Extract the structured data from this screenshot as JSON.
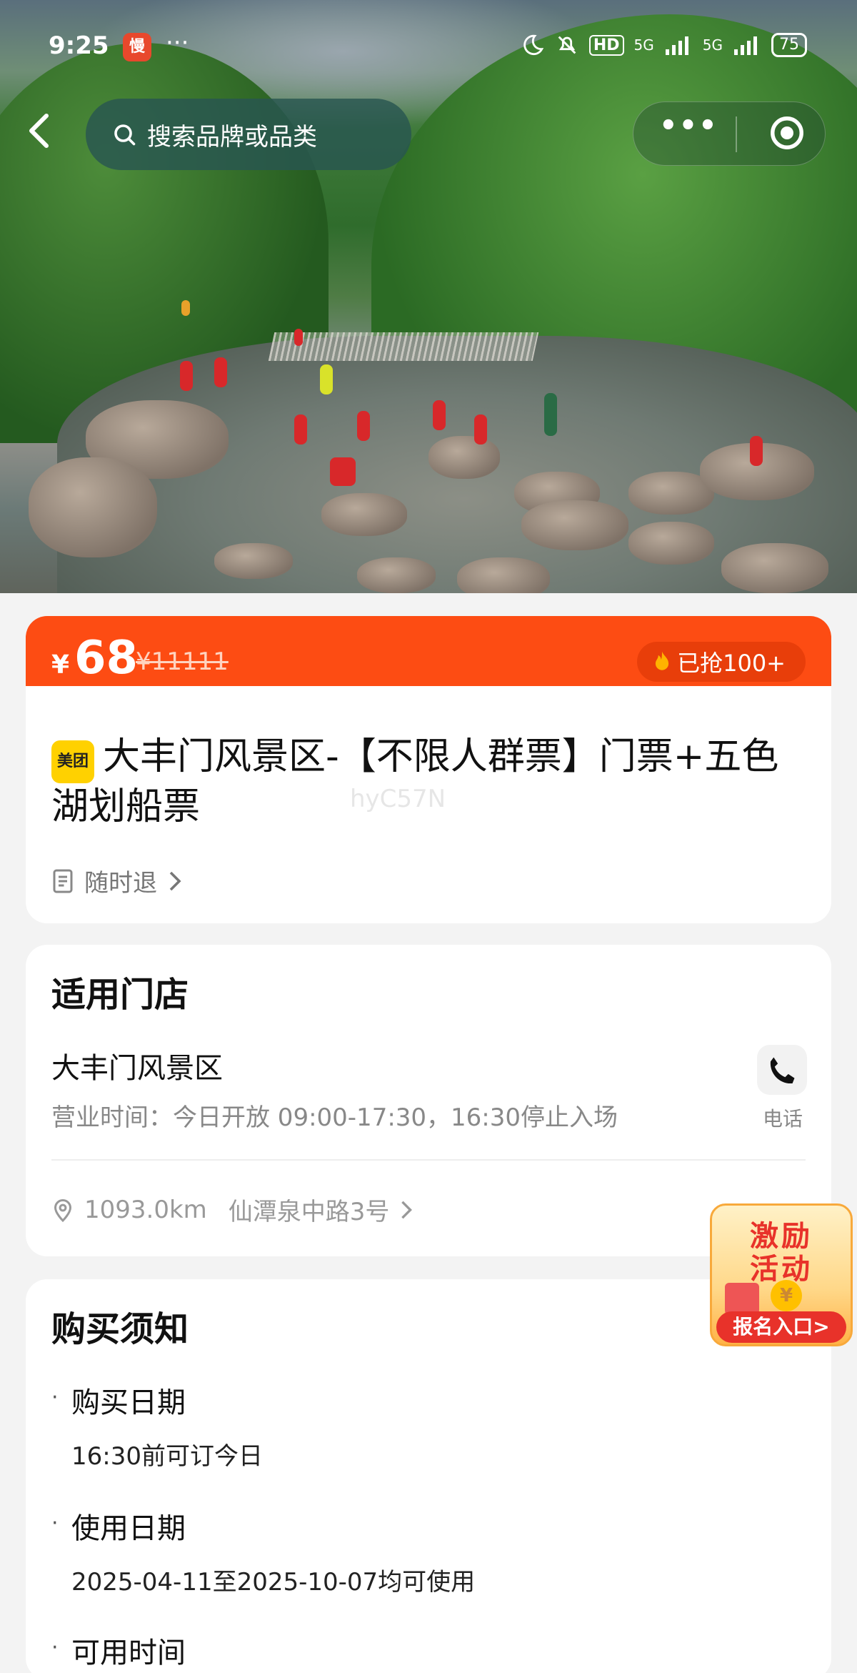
{
  "status_bar": {
    "time": "9:25",
    "app_badge": "慢",
    "dots": "···",
    "signal1": "5G",
    "signal2": "5G",
    "hd": "HD",
    "battery": "75"
  },
  "nav": {
    "search_placeholder": "搜索品牌或品类",
    "more": "•••"
  },
  "price": {
    "currency": "¥",
    "amount": "68",
    "original": "¥11111",
    "sold": "已抢100+"
  },
  "product": {
    "brand_badge": "美团",
    "title": "大丰门风景区-【不限人群票】门票+五色湖划船票",
    "refund": "随时退",
    "watermark": "hyC57N"
  },
  "store": {
    "section_title": "适用门店",
    "name": "大丰门风景区",
    "hours": "营业时间：今日开放 09:00-17:30，16:30停止入场",
    "phone_label": "电话",
    "distance": "1093.0km",
    "address": "仙潭泉中路3号"
  },
  "notice": {
    "section_title": "购买须知",
    "items": [
      {
        "heading": "购买日期",
        "value": "16:30前可订今日"
      },
      {
        "heading": "使用日期",
        "value": "2025-04-11至2025-10-07均可使用"
      },
      {
        "heading": "可用时间",
        "value": ""
      }
    ]
  },
  "promo": {
    "line1": "激励",
    "line2": "活动",
    "button": "报名入口>"
  },
  "colors": {
    "accent": "#fd4c13",
    "brand_yellow": "#ffd100",
    "promo_red": "#e8322a"
  }
}
